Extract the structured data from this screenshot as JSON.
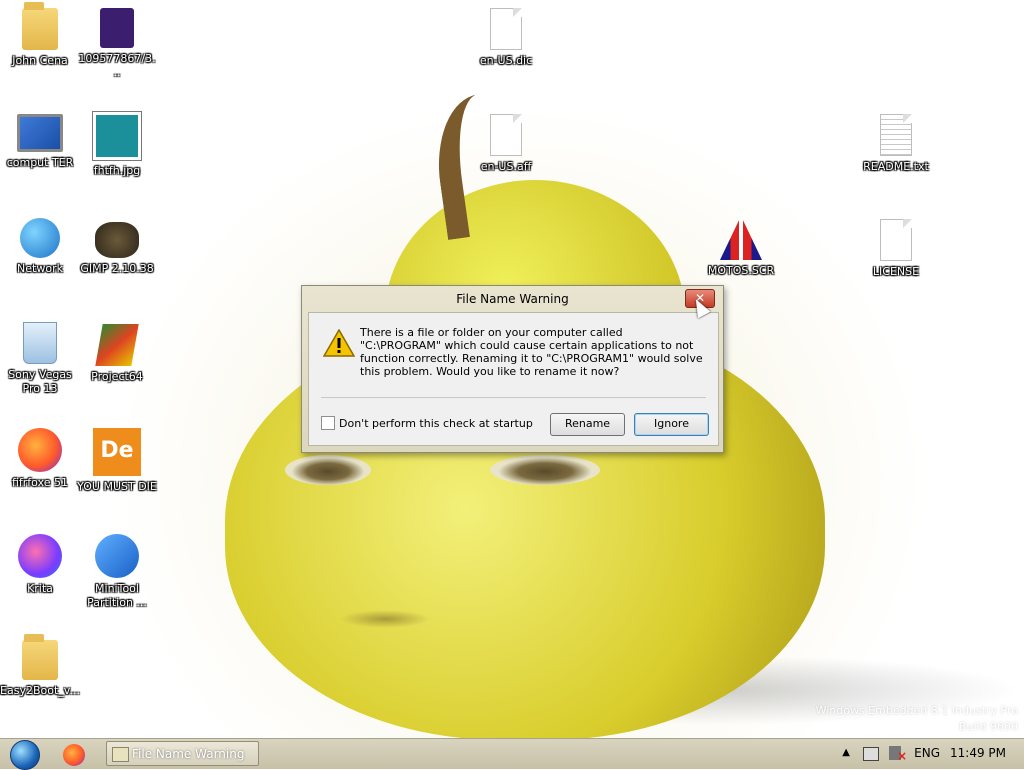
{
  "desktop": {
    "icons": [
      {
        "name": "john-cena-folder",
        "label": "John Cena"
      },
      {
        "name": "file-10957",
        "label": "109577867/3..."
      },
      {
        "name": "en-us-dic",
        "label": "en-US.dic"
      },
      {
        "name": "computer",
        "label": "comput TER"
      },
      {
        "name": "fhtfh-jpg",
        "label": "fhtfh.jpg"
      },
      {
        "name": "en-us-aff",
        "label": "en-US.aff"
      },
      {
        "name": "readme-txt",
        "label": "README.txt"
      },
      {
        "name": "network",
        "label": "Network"
      },
      {
        "name": "gimp",
        "label": "GIMP 2.10.38"
      },
      {
        "name": "motos-scr",
        "label": "MOTOS.SCR"
      },
      {
        "name": "license",
        "label": "LICENSE"
      },
      {
        "name": "sony-vegas",
        "label": "Sony Vegas Pro 13"
      },
      {
        "name": "project64",
        "label": "Project64"
      },
      {
        "name": "firefox",
        "label": "fifrfoxe 51"
      },
      {
        "name": "you-must-die",
        "label": "YOU MUST DIE"
      },
      {
        "name": "krita",
        "label": "Krita"
      },
      {
        "name": "minitool",
        "label": "MiniTool Partition ..."
      },
      {
        "name": "easy2boot",
        "label": "Easy2Boot_v..."
      }
    ],
    "watermark": [
      "Windows Embedded 8.1 Industry Pro",
      "Build 9600"
    ]
  },
  "dialog": {
    "title": "File Name Warning",
    "close_label": "✕",
    "message": "There is a file or folder on your computer called \"C:\\PROGRAM\" which could cause certain applications to not function correctly.  Renaming it to \"C:\\PROGRAM1\" would solve this problem.  Would you like to rename it now?",
    "checkbox_label": "Don't perform this check at startup",
    "checkbox_checked": false,
    "rename_label": "Rename",
    "ignore_label": "Ignore"
  },
  "taskbar": {
    "task_label": "File Name Warning",
    "tray_up": "▲",
    "language": "ENG",
    "clock": "11:49 PM"
  }
}
